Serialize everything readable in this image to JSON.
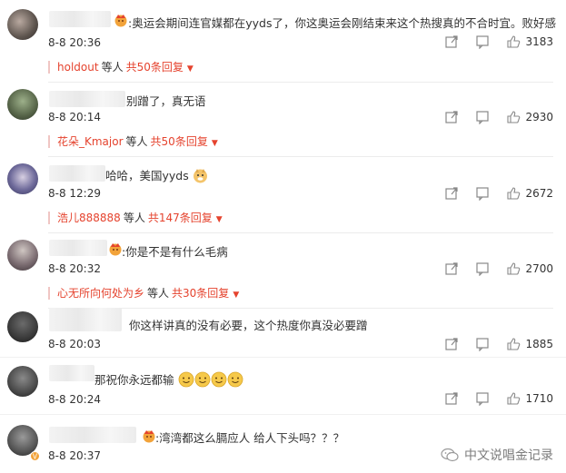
{
  "comments": [
    {
      "text": ":奥运会期间连官媒都在yyds了，你这奥运会刚结束来这个热搜真的不合时宜。败好感",
      "time": "8-8 20:36",
      "likes": "3183",
      "reply": {
        "who": "holdout",
        "mid": "等人",
        "count": "共50条回复"
      }
    },
    {
      "text": "别蹭了，真无语",
      "time": "8-8 20:14",
      "likes": "2930",
      "reply": {
        "who": "花朵_Kmajor",
        "mid": "等人",
        "count": "共50条回复"
      }
    },
    {
      "text": "哈哈，美国yyds",
      "time": "8-8 12:29",
      "likes": "2672",
      "reply": {
        "who": "浩儿888888",
        "mid": "等人",
        "count": "共147条回复"
      }
    },
    {
      "text": ":你是不是有什么毛病",
      "time": "8-8 20:32",
      "likes": "2700",
      "reply": {
        "who": "心无所向何处为乡",
        "mid": "等人",
        "count": "共30条回复"
      }
    },
    {
      "text": "你这样讲真的没有必要，这个热度你真没必要蹭",
      "time": "8-8 20:03",
      "likes": "1885"
    },
    {
      "text": "那祝你永远都输",
      "time": "8-8 20:24",
      "likes": "1710"
    },
    {
      "text": ":湾湾都这么膈应人 给人下头吗？？？",
      "time": "8-8 20:37",
      "likes": "0"
    }
  ],
  "watermark": "中文说唱金记录",
  "colors": {
    "accent": "#e5432e",
    "text": "#333333",
    "crown": "#f2a33a"
  }
}
